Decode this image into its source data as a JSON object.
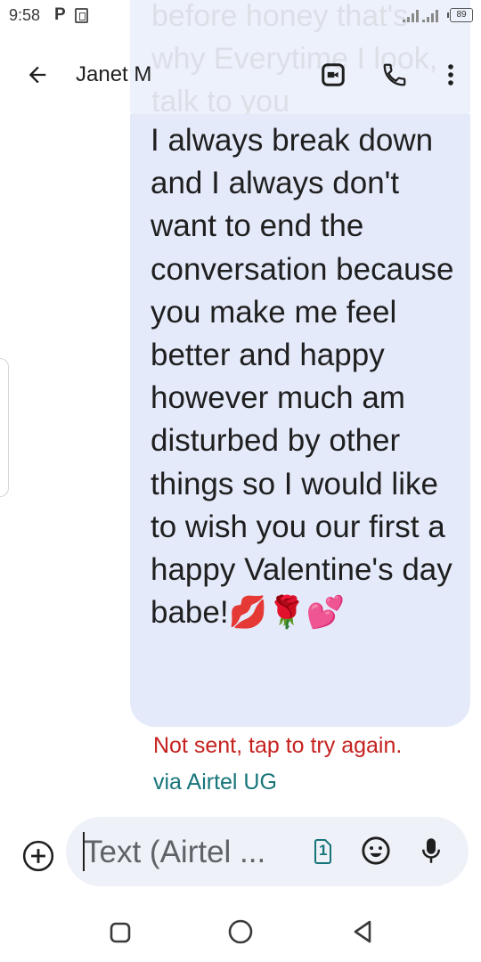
{
  "status_bar": {
    "time": "9:58",
    "notification_letter": "P",
    "battery_level": "89"
  },
  "ghost_text": "before honey that's why Everytime I look, talk to you",
  "app_bar": {
    "contact_name": "Janet M",
    "icons": [
      "back-arrow-icon",
      "video-call-icon",
      "phone-icon",
      "more-vert-icon"
    ]
  },
  "message": {
    "text": "I always break down and I always don't want to end the conversation because you make me feel better and happy however much am disturbed by other things so I would like to wish you our first a happy Valentine's day babe!💋🌹💕",
    "status": "Not sent, tap to try again.",
    "carrier": "via Airtel UG"
  },
  "compose": {
    "placeholder": "Text (Airtel ...",
    "sim_number": "1",
    "icons": [
      "add-circle-icon",
      "sim-card-icon",
      "emoji-icon",
      "mic-icon"
    ]
  },
  "nav_bar": {
    "icons": [
      "recents-icon",
      "home-icon",
      "back-triangle-icon"
    ]
  },
  "colors": {
    "bubble": "#e4eafa",
    "error": "#c5221f",
    "carrier": "#17757a",
    "compose_bg": "#eef1f8"
  }
}
